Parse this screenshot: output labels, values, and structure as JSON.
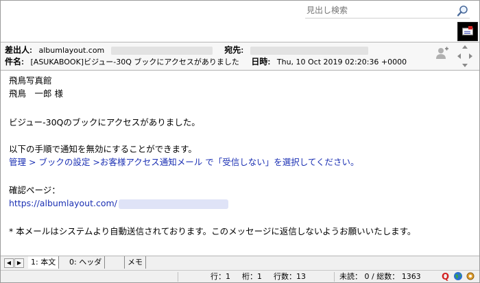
{
  "search": {
    "placeholder": "見出し検索"
  },
  "header": {
    "from_label": "差出人:",
    "from_value": "albumlayout.com",
    "to_label": "宛先:",
    "subject_label": "件名:",
    "subject_value": "[ASUKABOOK]ビジュー-30Q ブックにアクセスがありました",
    "date_label": "日時:",
    "date_value": "Thu, 10 Oct 2019 02:20:36 +0000"
  },
  "body": {
    "lines": [
      "飛鳥写真館",
      "飛鳥　一郎 様",
      "ビジュー-30Qのブックにアクセスがありました。",
      "以下の手順で通知を無効にすることができます。",
      "管理 > ブックの設定 >お客様アクセス通知メール で「受信しない」を選択してください。",
      "確認ページ：",
      "https://albumlayout.com/",
      "* 本メールはシステムより自動送信されております。このメッセージに返信しないようお願いいたします。"
    ]
  },
  "tabs": {
    "items": [
      "1: 本文",
      "0: ヘッダ",
      "メモ"
    ]
  },
  "status": {
    "row": "行：1",
    "col": "桁：1",
    "lines": "行数：13",
    "unread": "未読：  0 / 総数：  1363"
  },
  "colors": {
    "link": "#1a2fb3",
    "accent_red": "#d32020"
  }
}
